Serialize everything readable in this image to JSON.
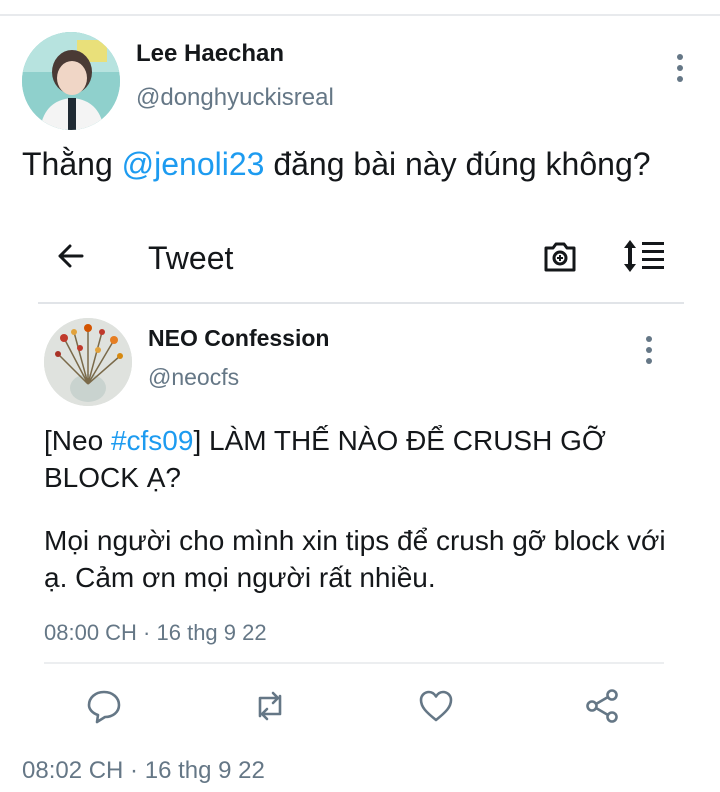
{
  "outer_tweet": {
    "author_name": "Lee Haechan",
    "author_handle": "@donghyuckisreal",
    "text_before": "Thằng ",
    "mention": "@jenoli23",
    "text_after": " đăng bài này đúng không?",
    "timestamp": "08:02 CH · 16 thg 9 22"
  },
  "screenshot": {
    "header_title": "Tweet",
    "tweet": {
      "author_name": "NEO Confession",
      "author_handle": "@neocfs",
      "title_prefix": "[Neo ",
      "hashtag": "#cfs09",
      "title_suffix": "] LÀM THẾ NÀO ĐỂ CRUSH GỠ BLOCK Ạ?",
      "body": "Mọi người cho mình xin tips để crush gỡ block với ạ. Cảm ơn mọi người rất nhiều.",
      "timestamp": "08:00 CH · 16 thg 9 22"
    }
  },
  "colors": {
    "link": "#1d9bf0",
    "muted": "#657786",
    "text": "#14171a"
  },
  "icons": [
    "more-vertical-icon",
    "back-arrow-icon",
    "camera-icon",
    "sort-icon",
    "reply-icon",
    "retweet-icon",
    "like-icon",
    "share-icon"
  ]
}
